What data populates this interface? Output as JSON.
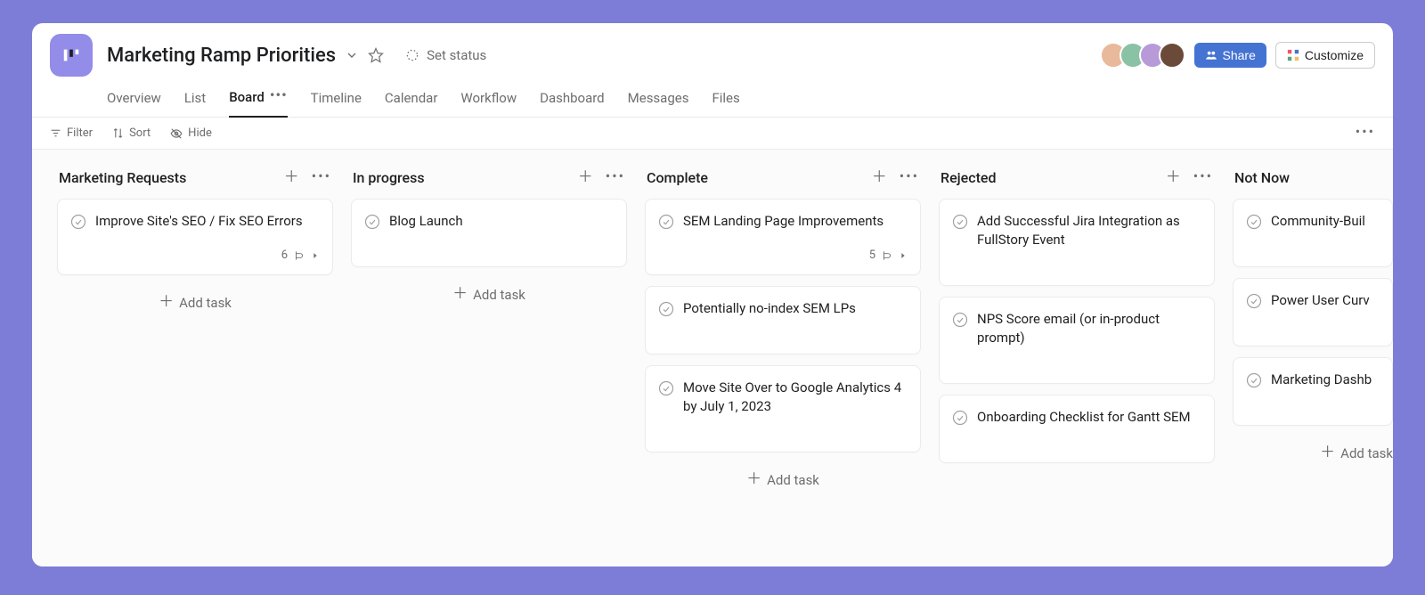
{
  "header": {
    "project_title": "Marketing Ramp Priorities",
    "set_status_label": "Set status",
    "share_label": "Share",
    "customize_label": "Customize",
    "avatars_count": 4
  },
  "tabs": [
    {
      "label": "Overview",
      "active": false
    },
    {
      "label": "List",
      "active": false
    },
    {
      "label": "Board",
      "active": true
    },
    {
      "label": "Timeline",
      "active": false
    },
    {
      "label": "Calendar",
      "active": false
    },
    {
      "label": "Workflow",
      "active": false
    },
    {
      "label": "Dashboard",
      "active": false
    },
    {
      "label": "Messages",
      "active": false
    },
    {
      "label": "Files",
      "active": false
    }
  ],
  "toolbar": {
    "filter": "Filter",
    "sort": "Sort",
    "hide": "Hide"
  },
  "add_task_label": "Add task",
  "columns": [
    {
      "title": "Marketing Requests",
      "cards": [
        {
          "title": "Improve Site's SEO / Fix SEO Errors",
          "subtasks": "6"
        }
      ],
      "show_add": true
    },
    {
      "title": "In progress",
      "cards": [
        {
          "title": "Blog Launch"
        }
      ],
      "show_add": true
    },
    {
      "title": "Complete",
      "cards": [
        {
          "title": "SEM Landing Page Improvements",
          "subtasks": "5"
        },
        {
          "title": "Potentially no-index SEM LPs"
        },
        {
          "title": "Move Site Over to Google Analytics 4 by July 1, 2023"
        }
      ],
      "show_add": true
    },
    {
      "title": "Rejected",
      "cards": [
        {
          "title": "Add Successful Jira Integration as FullStory Event"
        },
        {
          "title": "NPS Score email (or in-product prompt)"
        },
        {
          "title": "Onboarding Checklist for Gantt SEM"
        }
      ],
      "show_add": false
    },
    {
      "title": "Not Now",
      "cards": [
        {
          "title": "Community-Buil"
        },
        {
          "title": "Power User Curv"
        },
        {
          "title": "Marketing Dashb"
        }
      ],
      "show_add": true,
      "partial": true
    }
  ]
}
